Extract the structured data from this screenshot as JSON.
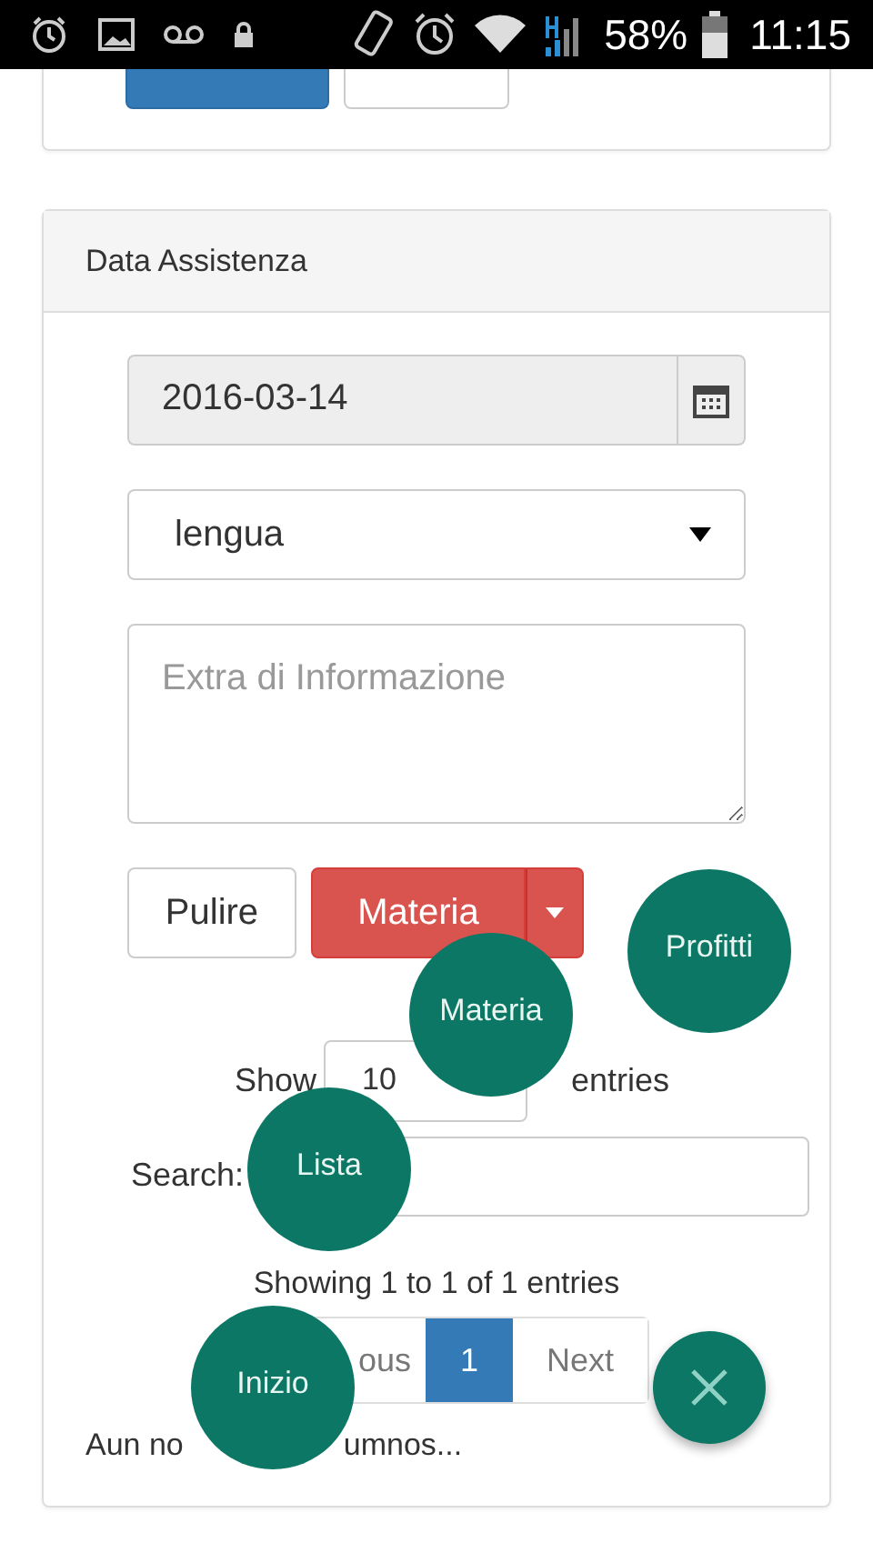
{
  "status_bar": {
    "battery": "58%",
    "time": "11:15"
  },
  "search_panel": {
    "buttons": [
      {
        "kind": "primary"
      },
      {
        "kind": "default"
      }
    ]
  },
  "assistance_panel": {
    "title": "Data Assistenza",
    "date": {
      "value": "2016-03-14"
    },
    "subject_select": {
      "value": "lengua"
    },
    "notes": {
      "placeholder": "Extra di Informazione"
    },
    "buttons": [
      {
        "label": "Pulire",
        "kind": "default"
      },
      {
        "label": "Materia",
        "kind": "split-danger"
      }
    ],
    "length": {
      "before": "Show",
      "value": "10",
      "after": "entries"
    },
    "search": {
      "label": "Search:"
    },
    "info": "Showing 1 to 1 of 1 entries",
    "pagination": [
      {
        "label": "ous",
        "selected": false
      },
      {
        "label": "1",
        "selected": true
      },
      {
        "label": "Next",
        "selected": false
      }
    ],
    "empty_message": [
      "Aun no",
      "umnos..."
    ]
  },
  "fab_menu": {
    "items": [
      {
        "label": "Profitti"
      },
      {
        "label": "Materia"
      },
      {
        "label": "Lista"
      },
      {
        "label": "Inizio"
      }
    ]
  }
}
